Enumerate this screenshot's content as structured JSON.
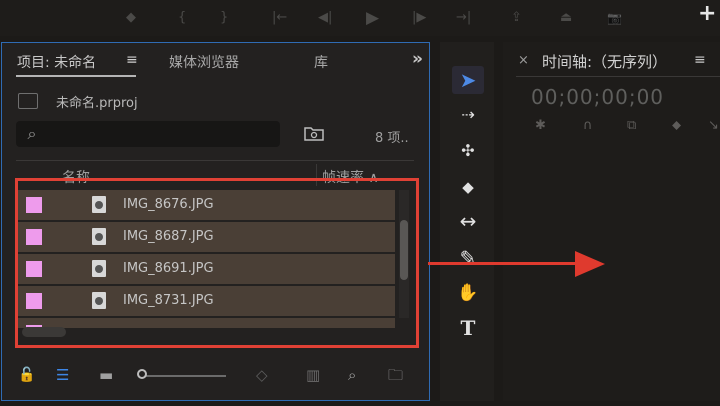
{
  "topbar": {
    "icons": [
      "marker-icon",
      "brace-open-icon",
      "brace-close-icon",
      "goto-in-icon",
      "step-back-icon",
      "play-icon",
      "step-forward-icon",
      "goto-out-icon",
      "lift-icon",
      "extract-icon",
      "camera-icon"
    ],
    "glyphs": [
      "◆",
      "{",
      "}",
      "|←",
      "◀|",
      "▶",
      "|▶",
      "→|",
      "⇪",
      "⏏",
      "📷"
    ],
    "add_label": "+"
  },
  "project_panel": {
    "tabs": [
      {
        "label": "项目: 未命名",
        "active": true
      },
      {
        "label": "媒体浏览器",
        "active": false
      },
      {
        "label": "库",
        "active": false
      }
    ],
    "menu_glyph": "≡",
    "overflow_glyph": "»",
    "file_name": "未命名.prproj",
    "search": {
      "placeholder": "",
      "icon": "search-icon"
    },
    "item_count": "8 项..",
    "columns": {
      "name": "名称",
      "fps": "帧速率 ∧"
    },
    "rows": [
      {
        "name": "IMG_8676.JPG"
      },
      {
        "name": "IMG_8687.JPG"
      },
      {
        "name": "IMG_8691.JPG"
      },
      {
        "name": "IMG_8731.JPG"
      }
    ],
    "label_color": "#ee9bec",
    "highlight_color": "#e04135"
  },
  "bottom_bar": {
    "lock_glyph": "🔓",
    "list_glyph": "☰",
    "icon_view_glyph": "▬",
    "sort_glyph": "◇",
    "automate_glyph": "▥",
    "find_glyph": "⌕",
    "folder_glyph": "🗀"
  },
  "tools": [
    {
      "name": "selection-tool",
      "glyph": "➤"
    },
    {
      "name": "track-select-tool",
      "glyph": "⇢"
    },
    {
      "name": "ripple-edit-tool",
      "glyph": "✣"
    },
    {
      "name": "razor-tool",
      "glyph": "◆"
    },
    {
      "name": "slip-tool",
      "glyph": "↔"
    },
    {
      "name": "pen-tool",
      "glyph": "✎"
    },
    {
      "name": "hand-tool",
      "glyph": "✋"
    },
    {
      "name": "type-tool",
      "glyph": "T"
    }
  ],
  "timeline": {
    "close_glyph": "×",
    "title": "时间轴:（无序列）",
    "menu_glyph": "≡",
    "timecode": "00;00;00;00",
    "tool_glyphs": [
      "✱",
      "∩",
      "⧉",
      "⬥",
      "↘"
    ]
  }
}
